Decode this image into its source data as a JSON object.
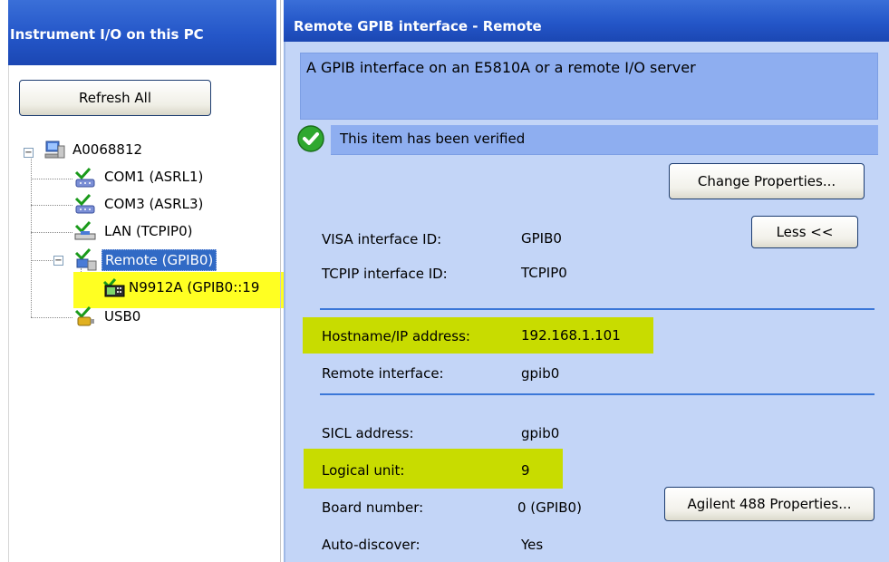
{
  "left_panel": {
    "title": "Instrument I/O on this PC",
    "refresh_button": "Refresh All",
    "tree": {
      "root": "A0068812",
      "com1": "COM1 (ASRL1)",
      "com3": "COM3 (ASRL3)",
      "lan": "LAN (TCPIP0)",
      "remote": "Remote (GPIB0)",
      "instrument": "N9912A (GPIB0::19",
      "usb": "USB0"
    }
  },
  "right_panel": {
    "title": "Remote GPIB interface - Remote",
    "description": "A GPIB interface on an E5810A or a remote I/O server",
    "verified_text": "This item has been verified",
    "change_properties_button": "Change Properties...",
    "less_button": "Less <<",
    "agilent_button": "Agilent 488 Properties...",
    "properties": {
      "visa_label": "VISA interface ID:",
      "visa_value": "GPIB0",
      "tcpip_label": "TCPIP interface ID:",
      "tcpip_value": "TCPIP0",
      "hostname_label": "Hostname/IP address:",
      "hostname_value": "192.168.1.101",
      "remote_label": "Remote interface:",
      "remote_value": "gpib0",
      "sicl_label": "SICL address:",
      "sicl_value": "gpib0",
      "logical_label": "Logical unit:",
      "logical_value": "9",
      "board_label": "Board number:",
      "board_value": "0 (GPIB0)",
      "autodiscover_label": "Auto-discover:",
      "autodiscover_value": "Yes"
    }
  },
  "colors": {
    "header_blue": "#2456c8",
    "panel_bg": "#c3d5f7",
    "highlight_yellow": "#ffff22",
    "highlight_lime": "#c8dc00",
    "selection_blue": "#316ac5"
  },
  "icons": [
    "computer-icon",
    "serial-port-icon",
    "lan-icon",
    "remote-interface-icon",
    "instrument-icon",
    "usb-icon",
    "verified-check-icon"
  ]
}
